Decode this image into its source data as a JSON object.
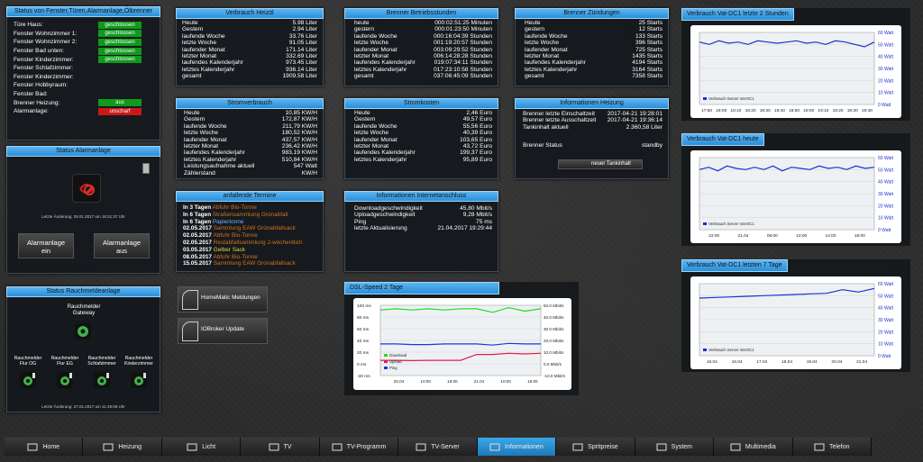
{
  "status_doors": {
    "title": "Status von Fenster,Türen,Alarmanlage,Ölbrenner",
    "items": [
      {
        "label": "Türe Haus:",
        "value": "geschlossen",
        "color": "green"
      },
      {
        "label": "Fenster Wohnzimmer 1:",
        "value": "geschlossen",
        "color": "green"
      },
      {
        "label": "Fenster Wohnzimmer 2:",
        "value": "geschlossen",
        "color": "green"
      },
      {
        "label": "Fenster Bad unten:",
        "value": "geschlossen",
        "color": "green"
      },
      {
        "label": "Fenster Kinderzimmer:",
        "value": "geschlossen",
        "color": "green"
      },
      {
        "label": "Fenster Schlafzimmer:",
        "value": "",
        "color": ""
      },
      {
        "label": "Fenster Kinderzimmer:",
        "value": "",
        "color": ""
      },
      {
        "label": "Fenster Hobbyraum:",
        "value": "",
        "color": ""
      },
      {
        "label": "Fenster Bad:",
        "value": "",
        "color": ""
      },
      {
        "label": "Brenner Heizung:",
        "value": "aus",
        "color": "green"
      },
      {
        "label": "Alarmanlage:",
        "value": "unscharf",
        "color": "red"
      }
    ]
  },
  "alarm": {
    "title": "Status Alarmanlage",
    "last_change": "Letzte Änderung: 29.01.2017 um 18:31:37 Uhr",
    "btn_on": "Alarmanlage ein",
    "btn_off": "Alarmanlage aus"
  },
  "smoke": {
    "title": "Status Rauchmeldeanlage",
    "gateway": "Rauchmelder Gateway",
    "detectors": [
      "Rauchmelder Flur OG",
      "Rauchmelder Flur EG",
      "Rauchmelder Schlafzimmer",
      "Rauchmelder Kinderzimmer"
    ],
    "last_change": "Letzte Änderung: 27.01.2017 um 11:49:06 Uhr"
  },
  "heating_oil": {
    "title": "Verbrauch Heizöl",
    "rows": [
      [
        "Heute",
        "5.98 Liter"
      ],
      [
        "Gestern",
        "2.94 Liter"
      ],
      [
        "laufende Woche",
        "33.76 Liter"
      ],
      [
        "letzte Woche",
        "91.05 Liter"
      ],
      [
        "laufender Monat",
        "171.14 Liter"
      ],
      [
        "letzter Monat",
        "332.69 Liter"
      ],
      [
        "laufendes Kalenderjahr",
        "973.45 Liter"
      ],
      [
        "letztes Kalenderjahr",
        "936.14 Liter"
      ],
      [
        "gesamt",
        "1909.58 Liter"
      ]
    ]
  },
  "burner_hours": {
    "title": "Brenner Betriebsstunden",
    "rows": [
      [
        "heute",
        "000:02:51:25 Minuten"
      ],
      [
        "gestern",
        "000:01:23:50 Minuten"
      ],
      [
        "laufende Woche",
        "000:16:04:39 Stunden"
      ],
      [
        "letzte Woche",
        "001:19:20:57 Stunden"
      ],
      [
        "laufender Monat",
        "003:09:29:52 Stunden"
      ],
      [
        "letzter Monat",
        "006:14:28:28 Stunden"
      ],
      [
        "laufendes Kalenderjahr",
        "019:07:34:11 Stunden"
      ],
      [
        "letztes Kalenderjahr",
        "017:23:10:58 Stunden"
      ],
      [
        "gesamt",
        "037:06:45:09 Stunden"
      ]
    ]
  },
  "burner_ignitions": {
    "title": "Brenner Zündungen",
    "rows": [
      [
        "Heute",
        "25 Starts"
      ],
      [
        "gestern",
        "12 Starts"
      ],
      [
        "laufende Woche",
        "133 Starts"
      ],
      [
        "letzte Woche",
        "396 Starts"
      ],
      [
        "laufender Monat",
        "725 Starts"
      ],
      [
        "letzter Monat",
        "1435 Starts"
      ],
      [
        "laufendes Kalenderjahr",
        "4194 Starts"
      ],
      [
        "letztes Kalenderjahr",
        "3164 Starts"
      ],
      [
        "gesamt",
        "7358 Starts"
      ]
    ]
  },
  "power": {
    "title": "Stromverbrauch",
    "rows": [
      [
        "Heute",
        "10,85 KW/H"
      ],
      [
        "Gestern",
        "172,87 KW/H"
      ],
      [
        "laufende Woche",
        "211,79 KW/H"
      ],
      [
        "letzte Woche",
        "180,52 KW/H"
      ],
      [
        "laufender Monat",
        "437,57 KW/H"
      ],
      [
        "letzter Monat",
        "236,42 KW/H"
      ],
      [
        "laufendes Kalenderjahr",
        "983,19 KW/H"
      ],
      [
        "letztes Kalenderjahr",
        "510,84 KW/H"
      ],
      [
        "Leistungsaufnahme aktuell",
        "547 Watt"
      ],
      [
        "Zählerstand",
        "KW/H"
      ]
    ]
  },
  "power_cost": {
    "title": "Stromkosten",
    "rows": [
      [
        "Heute",
        "2,46 Euro"
      ],
      [
        "Gestern",
        "49,57 Euro"
      ],
      [
        "laufende Woche",
        "55,56 Euro"
      ],
      [
        "letzte Woche",
        "40,39 Euro"
      ],
      [
        "laufender Monat",
        "103,65 Euro"
      ],
      [
        "letzter Monat",
        "43,72 Euro"
      ],
      [
        "laufendes Kalenderjahr",
        "199,37 Euro"
      ],
      [
        "letztes Kalenderjahr",
        "95,89 Euro"
      ]
    ]
  },
  "heating_info": {
    "title": "Informationen Heizung",
    "rows": [
      [
        "Brenner letzte Einschaltzeit",
        "2017-04-21 19:28:01"
      ],
      [
        "Brenner letzte Ausschaltzeit",
        "2017-04-21 19:36:14"
      ],
      [
        "Tankinhalt aktuell",
        "2.360,58 Liter"
      ]
    ],
    "status_label": "Brenner Status",
    "status_value": "standby",
    "tank_button": "neuer Tankinhalt"
  },
  "appointments": {
    "title": "anfallende Termine",
    "items": [
      {
        "when": "In 3 Tagen",
        "what": "Abfuhr Bio-Tonne",
        "style": "t"
      },
      {
        "when": "In 6 Tagen",
        "what": "Straßensammlung Grünabfall",
        "style": "t"
      },
      {
        "when": "In 6 Tagen",
        "what": "Papiertonne",
        "style": "t b"
      },
      {
        "when": "02.05.2017",
        "what": "Sammlung EAW Grünabfallsack",
        "style": "t"
      },
      {
        "when": "02.05.2017",
        "what": "Abfuhr Bio-Tonne",
        "style": "t"
      },
      {
        "when": "02.05.2017",
        "what": "Restabfallsammlung 2-wöchentlich",
        "style": "t"
      },
      {
        "when": "03.05.2017",
        "what": "Gelber Sack",
        "style": "t y"
      },
      {
        "when": "08.05.2017",
        "what": "Abfuhr Bio-Tonne",
        "style": "t"
      },
      {
        "when": "15.05.2017",
        "what": "Sammlung EAW Grünabfallsack",
        "style": "t"
      }
    ]
  },
  "internet": {
    "title": "Informationen Internetanschluss",
    "rows": [
      [
        "Downloadgeschwindigkeit",
        "45,80 Mbit/s"
      ],
      [
        "Uploadgeschwindigkeit",
        "9,28 Mbit/s"
      ],
      [
        "Ping",
        "75 ms"
      ],
      [
        "letzte Aktualisierung",
        "21.04.2017 19:29:44"
      ]
    ]
  },
  "buttons": {
    "homematic": "HomeMatic Meldungen",
    "iobroker": "IOBroker Update"
  },
  "dsl_chart": {
    "title": "DSL-Speed 2 Tage"
  },
  "vat2h": {
    "title": "Verbrauch Vat-DC1 letzte 2 Stunden"
  },
  "vatday": {
    "title": "Verbrauch Vat-DC1 heute"
  },
  "vat7d": {
    "title": "Verbrauch Vat-DC1 letzten 7 Tage"
  },
  "chart_data": [
    {
      "type": "line",
      "title": "DSL-Speed 2 Tage",
      "x": [
        "20.04",
        "10:00",
        "18:00",
        "21.04",
        "10:00",
        "18:00"
      ],
      "yleft_ticks": [
        "100 ms",
        "80 ms",
        "60 ms",
        "40 ms",
        "20 ms",
        "0 ms",
        "-20 ms"
      ],
      "yright_ticks": [
        "50.0 Mbit/s",
        "40.0 Mbit/s",
        "30.0 Mbit/s",
        "20.0 Mbit/s",
        "10.0 Mbit/s",
        "0.0 Mbit/s",
        "-10.0 Mbit/s"
      ],
      "series": [
        {
          "name": "Download",
          "color": "#22dd22",
          "values": [
            46,
            47,
            46,
            47,
            46,
            47,
            47,
            44,
            48,
            45,
            47
          ]
        },
        {
          "name": "Upload",
          "color": "#e0204a",
          "values": [
            3,
            3,
            2.8,
            3,
            3,
            3,
            8,
            8,
            9,
            8.5,
            9
          ]
        },
        {
          "name": "Ping",
          "color": "#2233dd",
          "values": [
            34,
            34,
            33,
            33,
            34,
            34,
            34,
            32,
            35,
            34,
            34
          ]
        }
      ]
    },
    {
      "type": "line",
      "title": "Verbrauch Vat-DC1 letzte 2 Stunden",
      "x": [
        "17:50",
        "18:00",
        "18:10",
        "18:20",
        "18:30",
        "18:40",
        "18:50",
        "19:00",
        "19:10",
        "19:20",
        "19:30",
        "19:40"
      ],
      "yright_ticks": [
        "60 Watt",
        "50 Watt",
        "40 Watt",
        "30 Watt",
        "20 Watt",
        "10 Watt",
        "0 Watt"
      ],
      "series": [
        {
          "name": "Verbrauch Server Vat-DC1",
          "color": "#1a2fd0",
          "values": [
            52,
            50,
            53,
            51,
            52,
            50,
            53,
            52,
            51,
            52,
            53,
            51,
            52,
            50,
            53,
            52,
            50,
            48,
            52
          ]
        }
      ]
    },
    {
      "type": "line",
      "title": "Verbrauch Vat-DC1 heute",
      "x": [
        "22:00",
        "21.04",
        "06:00",
        "10:00",
        "14:00",
        "18:00"
      ],
      "yright_ticks": [
        "60 Watt",
        "50 Watt",
        "40 Watt",
        "30 Watt",
        "20 Watt",
        "10 Watt",
        "0 Watt"
      ],
      "series": [
        {
          "name": "Verbrauch Server Vat-DC1",
          "color": "#1a2fd0",
          "values": [
            50,
            52,
            49,
            53,
            51,
            50,
            52,
            50,
            53,
            49,
            52,
            51,
            50,
            53,
            51,
            52,
            50,
            53,
            51,
            52
          ]
        }
      ]
    },
    {
      "type": "line",
      "title": "Verbrauch Vat-DC1 letzten 7 Tage",
      "x": [
        "16.04",
        "16.04",
        "17.04",
        "18.04",
        "19.04",
        "20.04",
        "21.04"
      ],
      "yright_ticks": [
        "60 Watt",
        "50 Watt",
        "40 Watt",
        "30 Watt",
        "20 Watt",
        "10 Watt",
        "0 Watt"
      ],
      "series": [
        {
          "name": "Verbrauch Server Vat-DC1",
          "color": "#1a2fd0",
          "values": [
            48,
            48.5,
            49,
            49.5,
            50,
            50.5,
            51,
            51.5,
            52,
            55,
            53,
            56
          ]
        }
      ]
    }
  ],
  "nav": [
    {
      "label": "Home",
      "icon": "house-icon",
      "active": false
    },
    {
      "label": "Heizung",
      "icon": "radiator-icon",
      "active": false
    },
    {
      "label": "Licht",
      "icon": "bulb-icon",
      "active": false
    },
    {
      "label": "TV",
      "icon": "tv-icon",
      "active": false
    },
    {
      "label": "TV-Programm",
      "icon": "tv-guide-icon",
      "active": false
    },
    {
      "label": "TV-Server",
      "icon": "tv-server-icon",
      "active": false
    },
    {
      "label": "Informationen",
      "icon": "warning-icon",
      "active": true
    },
    {
      "label": "Spritpreise",
      "icon": "fuel-icon",
      "active": false
    },
    {
      "label": "System",
      "icon": "hand-icon",
      "active": false
    },
    {
      "label": "Multimedia",
      "icon": "media-icon",
      "active": false
    },
    {
      "label": "Telefon",
      "icon": "phone-icon",
      "active": false
    }
  ]
}
